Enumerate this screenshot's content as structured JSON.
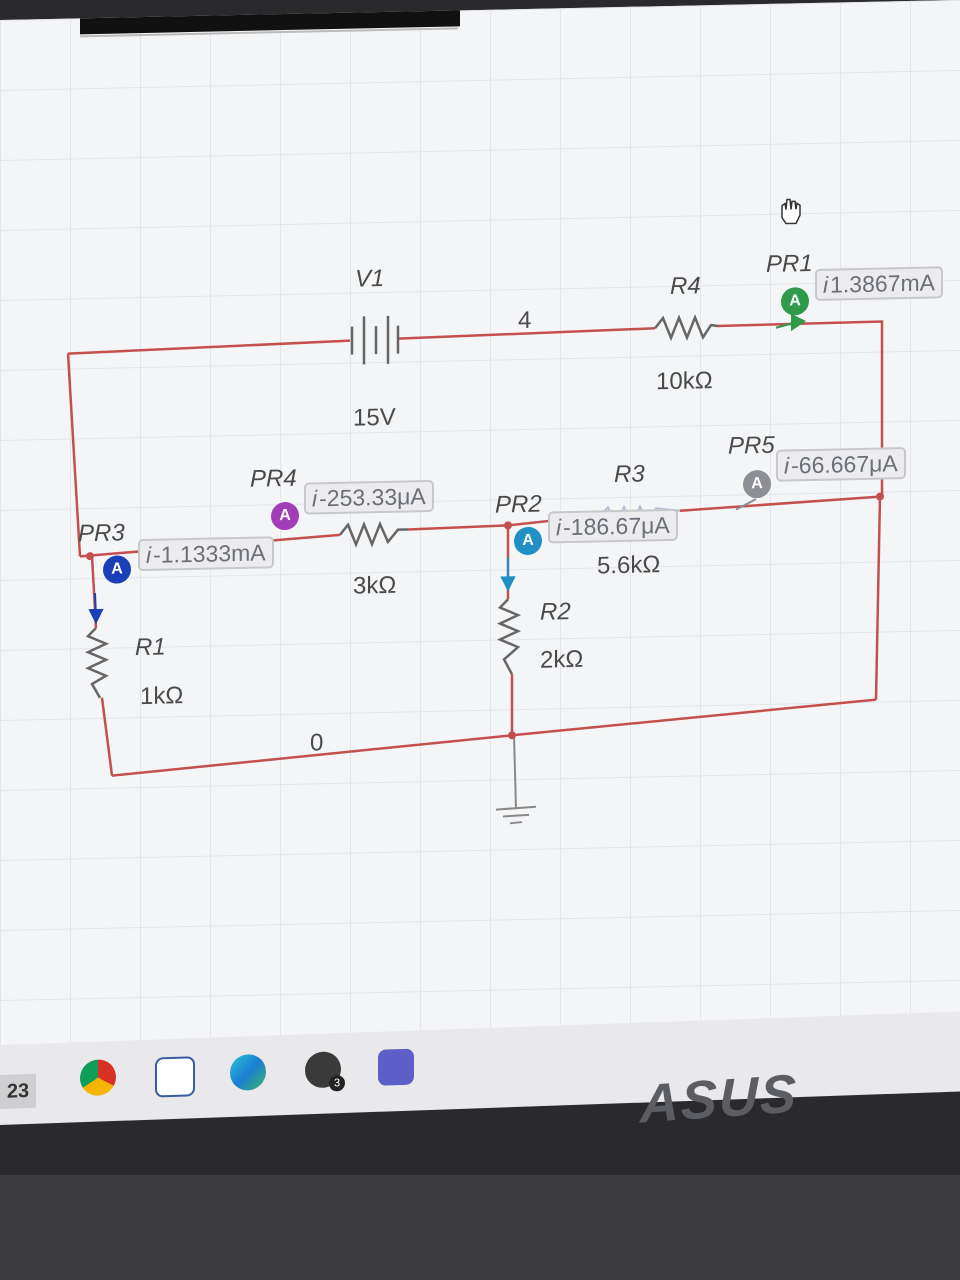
{
  "taskbar": {
    "time_fragment": "23",
    "icons": [
      "chrome-icon",
      "polygon-app-icon",
      "edge-icon",
      "whatsapp-icon",
      "teams-icon"
    ],
    "whatsapp_badge": "3"
  },
  "bezel": {
    "logo_text": "ASUS"
  },
  "schematic": {
    "nodes": {
      "top": "4",
      "ground": "0"
    },
    "battery": {
      "name": "V1",
      "value": "15V"
    },
    "resistors": [
      {
        "name": "R1",
        "value": "1kΩ"
      },
      {
        "name": "R2",
        "value": "2kΩ"
      },
      {
        "name": "R3",
        "value": "5.6kΩ"
      },
      {
        "name": "R4",
        "value": "10kΩ"
      },
      {
        "name": "",
        "value": "3kΩ"
      }
    ],
    "probes": [
      {
        "name": "PR1",
        "symbol": "A",
        "prefix": "i",
        "reading": "1.3867mA",
        "color": "#2e9a4a"
      },
      {
        "name": "PR2",
        "symbol": "A",
        "prefix": "i",
        "reading": "-186.67μA",
        "color": "#1f8fc4"
      },
      {
        "name": "PR3",
        "symbol": "A",
        "prefix": "i",
        "reading": "-1.1333mA",
        "color": "#1a3fb8"
      },
      {
        "name": "PR4",
        "symbol": "A",
        "prefix": "i",
        "reading": "-253.33μA",
        "color": "#a23db8"
      },
      {
        "name": "PR5",
        "symbol": "A",
        "prefix": "i",
        "reading": "-66.667μA",
        "color": "#8d8f94"
      }
    ],
    "wire_color": "#c44f4f"
  }
}
